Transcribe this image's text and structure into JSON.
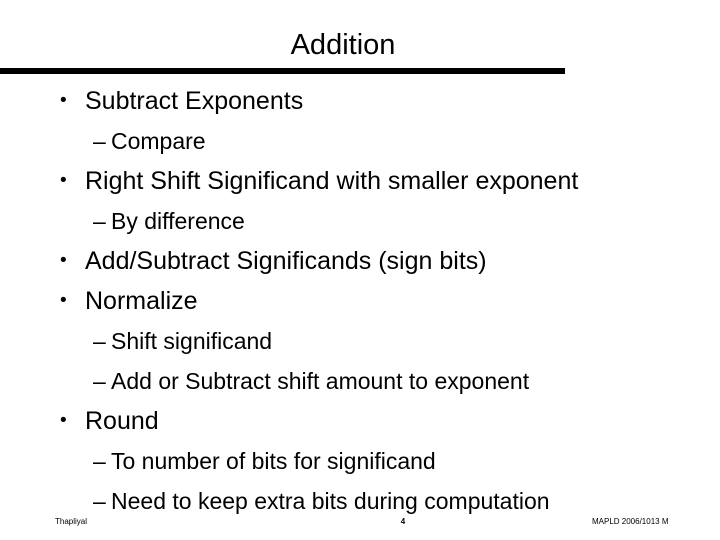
{
  "slide": {
    "title": "Addition",
    "background_color": "#ffffff",
    "text_color": "#000000",
    "rule_color": "#000000"
  },
  "body": {
    "items": [
      {
        "level": 1,
        "marker": "•",
        "text": "Subtract Exponents"
      },
      {
        "level": 2,
        "marker": "–",
        "text": "Compare"
      },
      {
        "level": 1,
        "marker": "•",
        "text": "Right Shift Significand with smaller exponent"
      },
      {
        "level": 2,
        "marker": "–",
        "text": "By difference"
      },
      {
        "level": 1,
        "marker": "•",
        "text": "Add/Subtract Significands (sign bits)"
      },
      {
        "level": 1,
        "marker": "•",
        "text": "Normalize"
      },
      {
        "level": 2,
        "marker": "–",
        "text": "Shift significand"
      },
      {
        "level": 2,
        "marker": "–",
        "text": "Add or Subtract shift amount to exponent"
      },
      {
        "level": 1,
        "marker": "•",
        "text": "Round"
      },
      {
        "level": 2,
        "marker": "–",
        "text": "To number of bits for significand"
      },
      {
        "level": 2,
        "marker": "–",
        "text": "Need to keep extra bits during computation"
      }
    ]
  },
  "footer": {
    "left": "Thapliyal",
    "center": "4",
    "right": "MAPLD 2006/1013 M"
  }
}
